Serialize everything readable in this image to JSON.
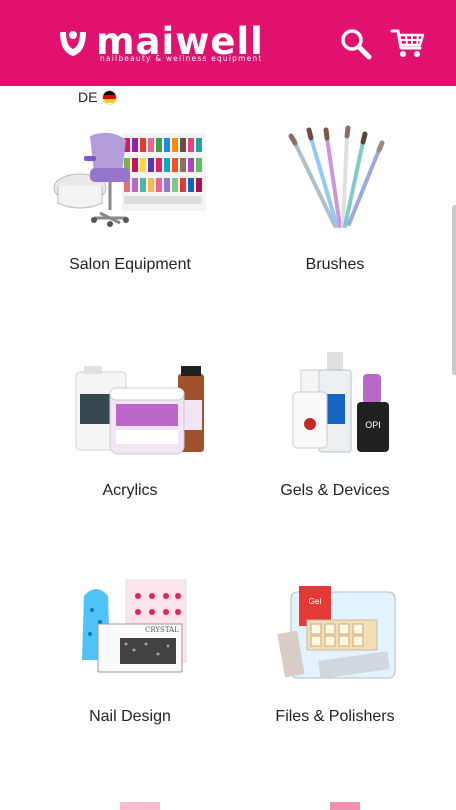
{
  "header": {
    "logo_text": "maiwell",
    "tagline": "nailbeauty & wellness equipment",
    "search_icon": "search-icon",
    "cart_icon": "shopping-cart-icon",
    "brand_color": "#e2106e"
  },
  "language": {
    "code": "DE",
    "flag_icon": "germany-flag-icon"
  },
  "categories": [
    {
      "label": "Salon Equipment",
      "icon": "pedicure-chair-image"
    },
    {
      "label": "Brushes",
      "icon": "nail-brushes-image"
    },
    {
      "label": "Acrylics",
      "icon": "acrylic-powder-image"
    },
    {
      "label": "Gels & Devices",
      "icon": "gel-polish-image"
    },
    {
      "label": "Nail Design",
      "icon": "nail-design-image"
    },
    {
      "label": "Files & Polishers",
      "icon": "nail-files-image"
    }
  ]
}
